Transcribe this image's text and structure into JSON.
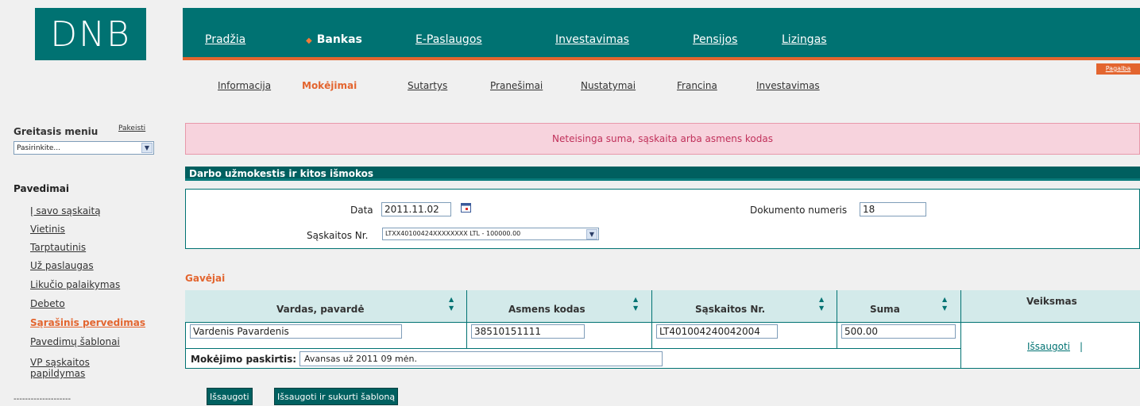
{
  "logo": "DNB",
  "help_link": "Pagalba",
  "topnav": [
    {
      "label": "Pradžia"
    },
    {
      "label": "Bankas",
      "active": true
    },
    {
      "label": "E-Paslaugos"
    },
    {
      "label": "Investavimas"
    },
    {
      "label": "Pensijos"
    },
    {
      "label": "Lizingas"
    }
  ],
  "subnav": [
    {
      "label": "Informacija"
    },
    {
      "label": "Mokėjimai",
      "active": true
    },
    {
      "label": "Sutartys"
    },
    {
      "label": "Pranešimai"
    },
    {
      "label": "Nustatymai"
    },
    {
      "label": "Francina"
    },
    {
      "label": "Investavimas"
    }
  ],
  "quick_menu": {
    "title": "Greitasis meniu",
    "change": "Pakeisti",
    "selected": "Pasirinkite..."
  },
  "sidebar": {
    "title": "Pavedimai",
    "items": [
      {
        "label": "Į savo sąskaitą"
      },
      {
        "label": "Vietinis"
      },
      {
        "label": "Tarptautinis"
      },
      {
        "label": "Už paslaugas"
      },
      {
        "label": "Likučio palaikymas"
      },
      {
        "label": "Debeto"
      },
      {
        "label": "Sąrašinis pervedimas",
        "active": true
      },
      {
        "label": "Pavedimų šablonai"
      },
      {
        "label": "VP sąskaitos"
      },
      {
        "label": "papildymas"
      }
    ],
    "separator": "--------------------"
  },
  "error_message": "Neteisinga suma, sąskaita arba asmens kodas",
  "section_title": "Darbo užmokestis ir kitos išmokos",
  "form": {
    "date_label": "Data",
    "date_value": "2011.11.02",
    "doc_label": "Dokumento numeris",
    "doc_value": "18",
    "account_label": "Sąskaitos Nr.",
    "account_value": "LTXX40100424XXXXXXXX LTL - 100000.00"
  },
  "recipients": {
    "title": "Gavėjai",
    "columns": [
      "Vardas, pavardė",
      "Asmens kodas",
      "Sąskaitos Nr.",
      "Suma",
      "Veiksmas"
    ],
    "row": {
      "name": "Vardenis Pavardenis",
      "personal_code": "38510151111",
      "account": "LT401004240042004",
      "amount": "500.00",
      "action": "Išsaugoti",
      "action_sep": "|"
    },
    "purpose_label": "Mokėjimo paskirtis:",
    "purpose_value": "Avansas už 2011 09 mėn."
  },
  "buttons": {
    "save": "Išsaugoti",
    "save_template": "Išsaugoti ir sukurti šabloną"
  }
}
